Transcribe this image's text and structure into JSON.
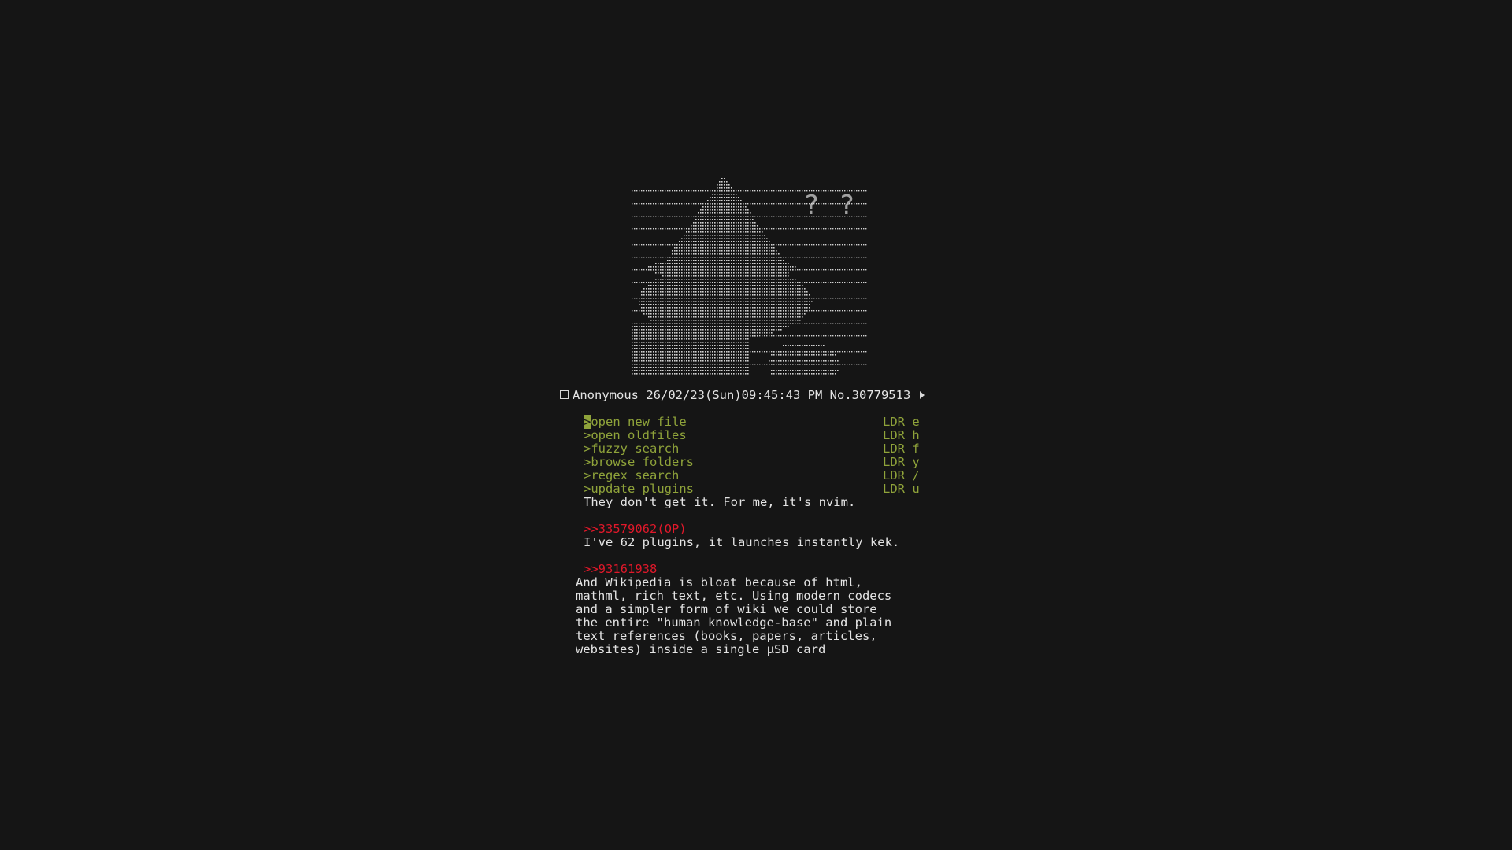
{
  "post": {
    "name": "Anonymous",
    "datetime": "26/02/23(Sun)09:45:43 PM",
    "number": "No.30779513"
  },
  "menu": {
    "items": [
      {
        "prefix": ">",
        "label": "open new file",
        "key": "LDR e"
      },
      {
        "prefix": ">",
        "label": "open oldfiles",
        "key": "LDR h"
      },
      {
        "prefix": ">",
        "label": "fuzzy search",
        "key": "LDR f"
      },
      {
        "prefix": ">",
        "label": "browse folders",
        "key": "LDR y"
      },
      {
        "prefix": ">",
        "label": "regex search",
        "key": "LDR /"
      },
      {
        "prefix": ">",
        "label": "update plugins",
        "key": "LDR u"
      }
    ]
  },
  "reply1": {
    "text": "They don't get it. For me, it's nvim."
  },
  "reply2": {
    "ref": ">>33579062(OP)",
    "text": "I've 62 plugins, it launches instantly kek."
  },
  "reply3": {
    "ref": ">>93161938",
    "lines": [
      "And Wikipedia is bloat because of html,",
      "mathml, rich text, etc. Using modern codecs",
      "and a simpler form of wiki we could store",
      "the entire \"human knowledge-base\" and plain",
      "text references (books, papers, articles,",
      "websites) inside a single µSD card"
    ]
  },
  "colors": {
    "background": "#151515",
    "text": "#e4e4e4",
    "greentext": "#8fa33a",
    "quote_link": "#e0182a",
    "ascii_dots": "#d0d0d0"
  },
  "ascii_art": {
    "icon": "pepe-wizard-ascii-art"
  }
}
